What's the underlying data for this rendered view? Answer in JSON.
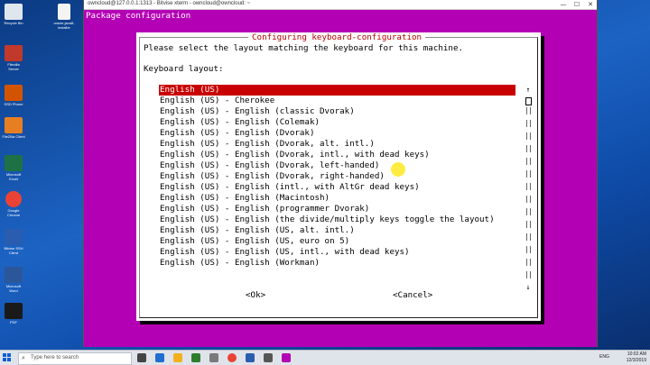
{
  "window": {
    "title": "owncloud@127.0.0.1:1313 - Bitvise xterm - owncloud@owncloud: ~",
    "minimize": "—",
    "maximize": "☐",
    "close": "✕"
  },
  "terminal": {
    "header": "Package configuration"
  },
  "dialog": {
    "title": "Configuring keyboard-configuration",
    "prompt": "Please select the layout matching the keyboard for this machine.",
    "layout_label": "Keyboard layout:",
    "items": [
      "English (US)",
      "English (US) - Cherokee",
      "English (US) - English (classic Dvorak)",
      "English (US) - English (Colemak)",
      "English (US) - English (Dvorak)",
      "English (US) - English (Dvorak, alt. intl.)",
      "English (US) - English (Dvorak, intl., with dead keys)",
      "English (US) - English (Dvorak, left-handed)",
      "English (US) - English (Dvorak, right-handed)",
      "English (US) - English (intl., with AltGr dead keys)",
      "English (US) - English (Macintosh)",
      "English (US) - English (programmer Dvorak)",
      "English (US) - English (the divide/multiply keys toggle the layout)",
      "English (US) - English (US, alt. intl.)",
      "English (US) - English (US, euro on 5)",
      "English (US) - English (US, intl., with dead keys)",
      "English (US) - English (Workman)"
    ],
    "scroll_up": "↑",
    "scroll_down": "↓",
    "ok": "<Ok>",
    "cancel": "<Cancel>"
  },
  "desktop_icons": [
    {
      "label": "Recycle Bin",
      "color": "#dfe6ee"
    },
    {
      "label": "Filezilla Server",
      "color": "#c0392b"
    },
    {
      "label": "SSD Phone",
      "color": "#d35400"
    },
    {
      "label": "FileZilla Client",
      "color": "#e67e22"
    },
    {
      "label": "Microsoft Excel",
      "color": "#1e7145"
    },
    {
      "label": "Google Chrome",
      "color": "#ea4335"
    },
    {
      "label": "Bitvise SSH Client",
      "color": "#2a5db0"
    },
    {
      "label": "Microsoft Word",
      "color": "#2b579a"
    },
    {
      "label": "PDF",
      "color": "#1a1a1a"
    }
  ],
  "desktop_file": {
    "label": "oracle-java8-installer",
    "color": "#f4f4f4"
  },
  "taskbar": {
    "search_placeholder": "Type here to search",
    "language": "ENG",
    "time": "10:02 AM",
    "date": "12/3/2019",
    "app_colors": [
      "#444",
      "#1f6fd1",
      "#f2b01e",
      "#2d7d2d",
      "#ea4335",
      "#7a7a7a",
      "#2a5db0",
      "#b400b4"
    ]
  }
}
